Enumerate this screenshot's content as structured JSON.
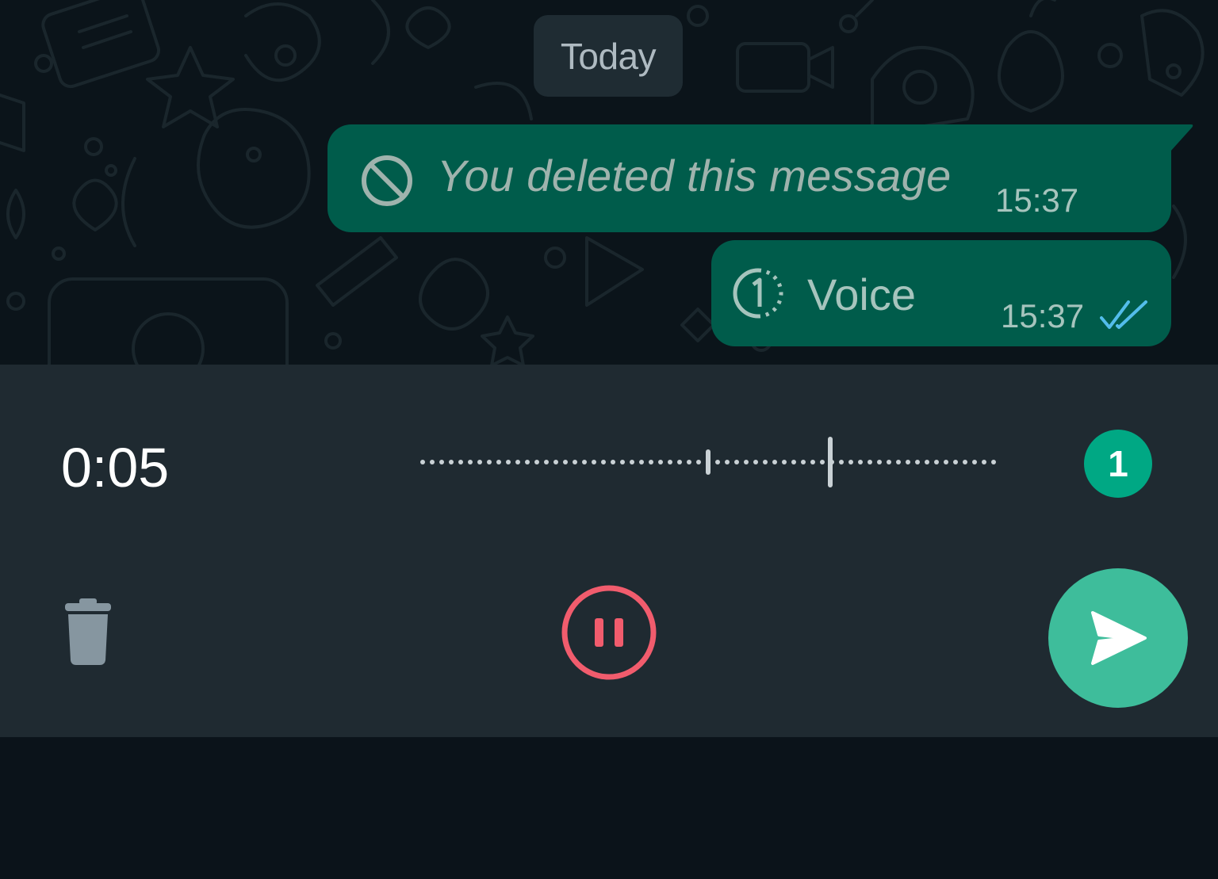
{
  "chat": {
    "date_separator": "Today",
    "messages": [
      {
        "type": "deleted",
        "text": "You deleted this message",
        "time": "15:37",
        "icon": "block-icon"
      },
      {
        "type": "view-once-voice",
        "label": "Voice",
        "time": "15:37",
        "icon": "view-once-icon",
        "status": "read",
        "status_icon": "double-check-icon"
      }
    ]
  },
  "recorder": {
    "elapsed": "0:05",
    "view_once_label": "1",
    "state": "recording"
  },
  "colors": {
    "background": "#0b141a",
    "outgoing_bubble": "#005c4b",
    "panel": "#1f2a31",
    "accent_green": "#00a884",
    "send_button": "#3ebd9b",
    "pause_red": "#f15c6d",
    "read_ticks": "#53bdeb"
  }
}
